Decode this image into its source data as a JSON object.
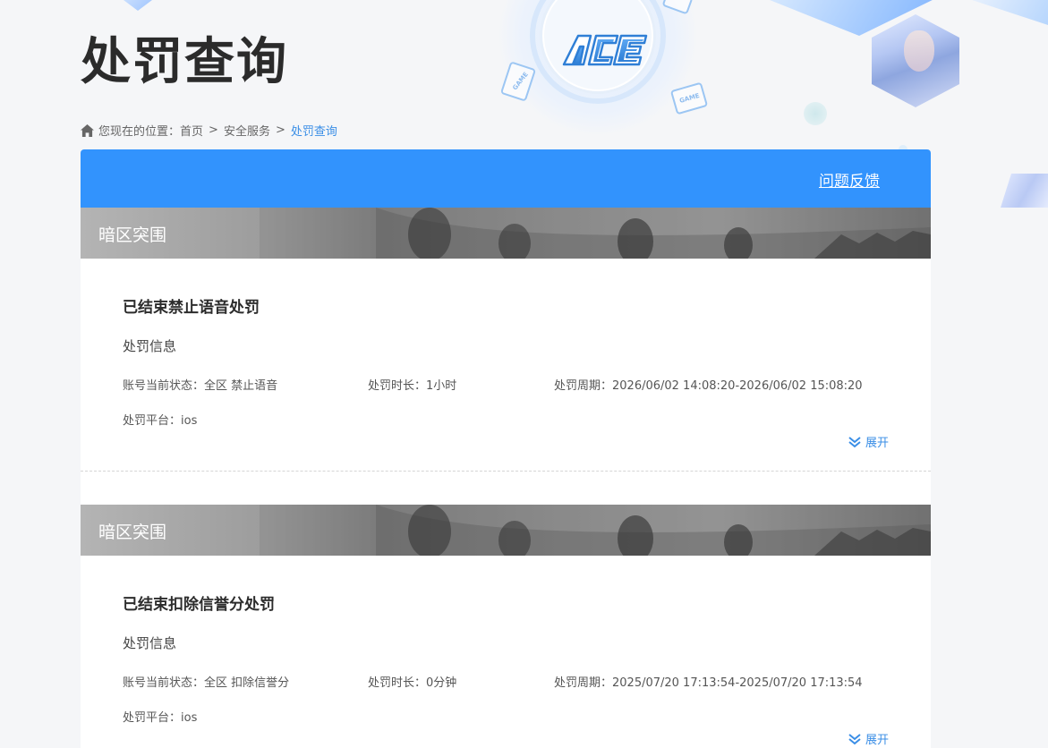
{
  "page": {
    "title": "处罚查询"
  },
  "breadcrumb": {
    "prefix": "您现在的位置：",
    "items": [
      "首页",
      "安全服务",
      "处罚查询"
    ],
    "separator": ">"
  },
  "header_bar": {
    "feedback_label": "问题反馈"
  },
  "records": [
    {
      "game": "暗区突围",
      "title": "已结束禁止语音处罚",
      "section_label": "处罚信息",
      "status": "账号当前状态：全区 禁止语音",
      "duration": "处罚时长：1小时",
      "period": "处罚周期：2026/06/02 14:08:20-2026/06/02 15:08:20",
      "platform": "处罚平台：ios",
      "expand_label": "展开"
    },
    {
      "game": "暗区突围",
      "title": "已结束扣除信誉分处罚",
      "section_label": "处罚信息",
      "status": "账号当前状态：全区 扣除信誉分",
      "duration": "处罚时长：0分钟",
      "period": "处罚周期：2025/07/20 17:13:54-2025/07/20 17:13:54",
      "platform": "处罚平台：ios",
      "expand_label": "展开"
    }
  ],
  "logo_text": "ACE",
  "decor": {
    "game_badge": "GAME"
  },
  "colors": {
    "accent": "#3293fd",
    "link": "#3a8ee6",
    "background": "#f5f6f8"
  }
}
